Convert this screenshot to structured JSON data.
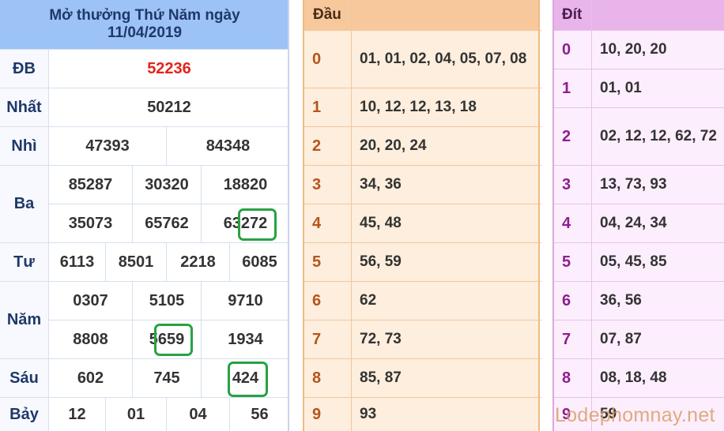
{
  "results": {
    "title_line1": "Mở thưởng Thứ Năm ngày",
    "title_line2": "11/04/2019",
    "rows": {
      "db": {
        "label": "ĐB",
        "values": [
          "52236"
        ]
      },
      "nhat": {
        "label": "Nhất",
        "values": [
          "50212"
        ]
      },
      "nhi": {
        "label": "Nhì",
        "values": [
          "47393",
          "84348"
        ]
      },
      "ba": {
        "label": "Ba",
        "values": [
          "85287",
          "30320",
          "18820",
          "35073",
          "65762",
          "63272"
        ]
      },
      "tu": {
        "label": "Tư",
        "values": [
          "6113",
          "8501",
          "2218",
          "6085"
        ]
      },
      "nam": {
        "label": "Năm",
        "values": [
          "0307",
          "5105",
          "9710",
          "8808",
          "5659",
          "1934"
        ]
      },
      "sau": {
        "label": "Sáu",
        "values": [
          "602",
          "745",
          "424"
        ]
      },
      "bay": {
        "label": "Bảy",
        "values": [
          "12",
          "01",
          "04",
          "56"
        ]
      }
    }
  },
  "dau": {
    "header": "Đầu",
    "rows": [
      {
        "key": "0",
        "value": "01, 01, 02, 04, 05, 07, 08"
      },
      {
        "key": "1",
        "value": "10, 12, 12, 13, 18"
      },
      {
        "key": "2",
        "value": "20, 20, 24"
      },
      {
        "key": "3",
        "value": "34, 36"
      },
      {
        "key": "4",
        "value": "45, 48"
      },
      {
        "key": "5",
        "value": "56, 59"
      },
      {
        "key": "6",
        "value": "62"
      },
      {
        "key": "7",
        "value": "72, 73"
      },
      {
        "key": "8",
        "value": "85, 87"
      },
      {
        "key": "9",
        "value": "93"
      }
    ]
  },
  "dit": {
    "header": "Đít",
    "rows": [
      {
        "key": "0",
        "value": "10, 20, 20"
      },
      {
        "key": "1",
        "value": "01, 01"
      },
      {
        "key": "2",
        "value": "02, 12, 12, 62, 72"
      },
      {
        "key": "3",
        "value": "13, 73, 93"
      },
      {
        "key": "4",
        "value": "04, 24, 34"
      },
      {
        "key": "5",
        "value": "05, 45, 85"
      },
      {
        "key": "6",
        "value": "36, 56"
      },
      {
        "key": "7",
        "value": "07, 87"
      },
      {
        "key": "8",
        "value": "08, 18, 48"
      },
      {
        "key": "9",
        "value": "59"
      }
    ]
  },
  "watermark": "Lodephomnay.net",
  "colors": {
    "special_prize": "#e2241b",
    "highlight_box": "#27a243",
    "results_header": "#9cc2f6",
    "dau_header": "#f7c89c",
    "dit_header": "#e8b4ea"
  }
}
